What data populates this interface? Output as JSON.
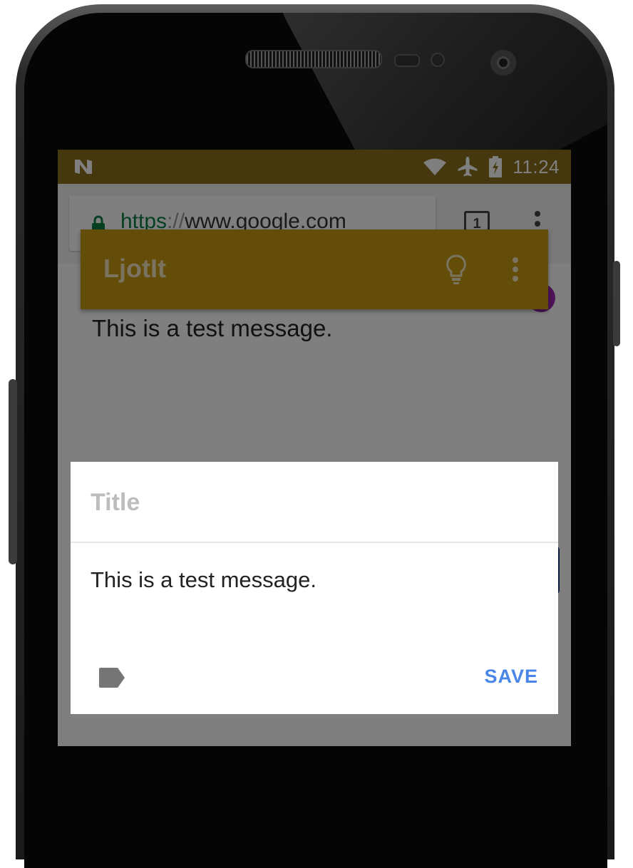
{
  "status_bar": {
    "time": "11:24",
    "notification_icon": "n-logo-icon",
    "icons": [
      "wifi-icon",
      "airplane-mode-icon",
      "battery-charging-icon"
    ]
  },
  "browser": {
    "url_scheme": "https",
    "url_slashes": "://",
    "url_host": "www.google.com",
    "tab_count": "1",
    "page_text": "This is a test message."
  },
  "app_bar": {
    "title": "LjotIt",
    "bulb_icon": "lightbulb-icon",
    "menu_icon": "more-vert-icon"
  },
  "dialog": {
    "title_placeholder": "Title",
    "body": "This is a test message.",
    "label_icon": "label-tag-icon",
    "save_label": "SAVE"
  },
  "colors": {
    "app_bar": "#c89a12",
    "status_bar": "#8a6f1c",
    "save_accent": "#4a86e8"
  }
}
